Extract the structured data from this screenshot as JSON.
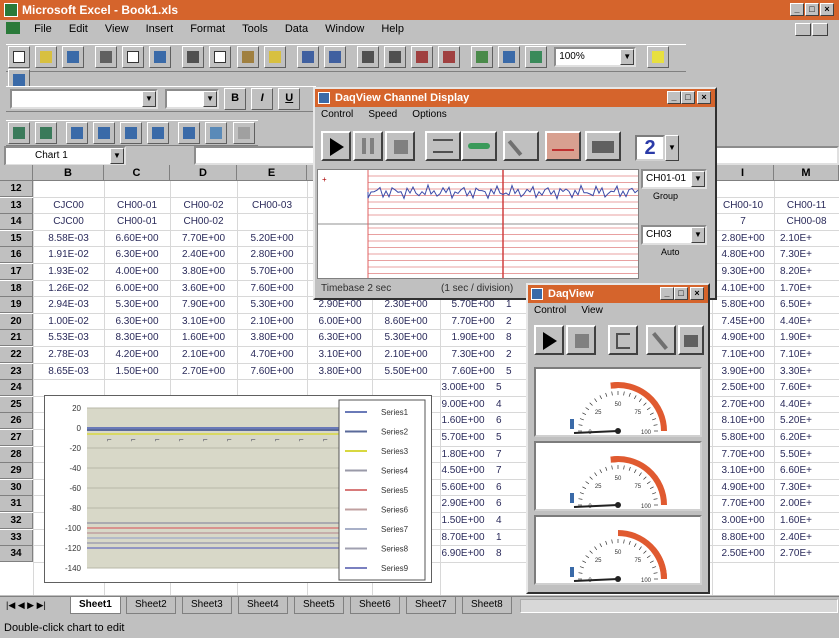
{
  "app": {
    "title": "Microsoft Excel - Book1.xls",
    "min": "_",
    "max": "□",
    "close": "×"
  },
  "menu": [
    "File",
    "Edit",
    "View",
    "Insert",
    "Format",
    "Tools",
    "Data",
    "Window",
    "Help"
  ],
  "toolbar": {
    "zoom": "100%",
    "bold": "B",
    "italic": "I",
    "underline": "U"
  },
  "namebox": "Chart 1",
  "columns": [
    "B",
    "C",
    "D",
    "E",
    "I",
    "M"
  ],
  "rows": [
    "12",
    "13",
    "14",
    "15",
    "16",
    "17",
    "18",
    "19",
    "20",
    "21",
    "22",
    "23",
    "24",
    "25",
    "26",
    "27",
    "28",
    "29",
    "30",
    "31",
    "32",
    "33",
    "34"
  ],
  "cells": {
    "r13": [
      "CJC00",
      "CH00-01",
      "CH00-02",
      "CH00-03",
      "CH00-10",
      "CH00-11"
    ],
    "r14": [
      "CJC00",
      "CH00-01",
      "CH00-02",
      "",
      "7",
      "CH00-08"
    ],
    "colB": [
      "8.58E-03",
      "1.91E-02",
      "1.93E-02",
      "1.26E-02",
      "2.94E-03",
      "1.00E-02",
      "5.53E-03",
      "2.78E-03",
      "8.65E-03"
    ],
    "colC": [
      "6.60E+00",
      "6.30E+00",
      "4.00E+00",
      "6.00E+00",
      "5.30E+00",
      "6.30E+00",
      "8.30E+00",
      "4.20E+00",
      "1.50E+00"
    ],
    "colD": [
      "7.70E+00",
      "2.40E+00",
      "3.80E+00",
      "3.60E+00",
      "7.90E+00",
      "3.10E+00",
      "1.60E+00",
      "2.10E+00",
      "2.70E+00"
    ],
    "colE": [
      "5.20E+00",
      "2.80E+00",
      "5.70E+00",
      "7.60E+00",
      "5.30E+00",
      "2.10E+00",
      "3.80E+00",
      "4.70E+00",
      "7.60E+00"
    ],
    "colI": [
      "2.80E+00",
      "4.80E+00",
      "9.30E+00",
      "4.10E+00",
      "5.80E+00",
      "7.45E+00",
      "4.90E+00",
      "7.10E+00",
      "3.90E+00",
      "2.50E+00",
      "2.70E+00",
      "8.10E+00",
      "5.80E+00",
      "7.70E+00",
      "3.10E+00",
      "4.90E+00",
      "7.70E+00",
      "3.00E+00",
      "8.80E+00",
      "2.50E+00"
    ],
    "colM": [
      "2.10E+",
      "7.30E+",
      "8.20E+",
      "1.70E+",
      "6.50E+",
      "4.40E+",
      "1.90E+",
      "7.10E+",
      "3.30E+",
      "7.60E+",
      "4.40E+",
      "5.20E+",
      "6.20E+",
      "5.50E+",
      "6.60E+",
      "7.30E+",
      "2.00E+",
      "1.60E+",
      "2.40E+",
      "2.70E+"
    ],
    "row19": [
      "2.90E+00",
      "2.30E+00",
      "5.70E+00",
      "1"
    ],
    "row20": [
      "6.00E+00",
      "8.60E+00",
      "7.70E+00",
      "2"
    ],
    "row21": [
      "6.30E+00",
      "5.30E+00",
      "1.90E+00",
      "8"
    ],
    "row22": [
      "3.10E+00",
      "2.10E+00",
      "7.30E+00",
      "2"
    ],
    "row23": [
      "3.80E+00",
      "5.50E+00",
      "7.60E+00",
      "5"
    ],
    "colH": [
      "3.00E+00",
      "9.00E+00",
      "1.60E+00",
      "5.70E+00",
      "1.80E+00",
      "4.50E+00",
      "5.60E+00",
      "2.90E+00",
      "1.50E+00",
      "8.70E+00",
      "6.90E+00"
    ],
    "colHn": [
      "5",
      "4",
      "6",
      "5",
      "7",
      "7",
      "6",
      "6",
      "4",
      "1",
      "8"
    ]
  },
  "chart": {
    "chart_data": {
      "type": "line",
      "yticks": [
        "20",
        "0",
        "-20",
        "-40",
        "-60",
        "-80",
        "-100",
        "-120",
        "-140"
      ],
      "ylim": [
        -140,
        20
      ],
      "series": [
        {
          "name": "Series1"
        },
        {
          "name": "Series2"
        },
        {
          "name": "Series3"
        },
        {
          "name": "Series4"
        },
        {
          "name": "Series5"
        },
        {
          "name": "Series6"
        },
        {
          "name": "Series7"
        },
        {
          "name": "Series8"
        },
        {
          "name": "Series9"
        }
      ]
    },
    "colors": [
      "#6a7ab8",
      "#5a6a9a",
      "#d8d840",
      "#9a9aa8",
      "#d87a7a",
      "#c0a0a0",
      "#a8b0c8",
      "#a0a0b0",
      "#7a80c0"
    ]
  },
  "daqview1": {
    "title": "DaqView Channel Display",
    "menu": [
      "Control",
      "Speed",
      "Options"
    ],
    "count": "2",
    "ch1": "CH01-01",
    "ch1sub": "Group",
    "ch2": "CH03",
    "ch2sub": "Auto",
    "timebase": "Timebase 2 sec",
    "scale": "(1 sec / division)"
  },
  "daqview2": {
    "title": "DaqView",
    "menu": [
      "Control",
      "View"
    ],
    "gauge_ticks": [
      "25",
      "50",
      "75",
      "0",
      "100"
    ]
  },
  "sheets": [
    "Sheet1",
    "Sheet2",
    "Sheet3",
    "Sheet4",
    "Sheet5",
    "Sheet6",
    "Sheet7",
    "Sheet8"
  ],
  "status": "Double-click chart to edit"
}
